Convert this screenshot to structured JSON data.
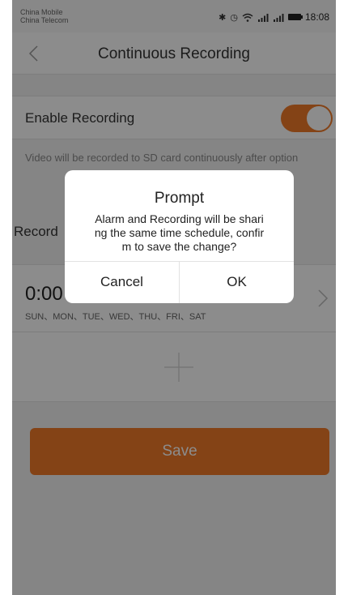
{
  "status_bar": {
    "carrier_1": "China Mobile",
    "carrier_2": "China Telecom",
    "time": "18:08",
    "icons": [
      "bluetooth-icon",
      "alarm-icon",
      "wifi-icon",
      "signal-icon",
      "signal-icon",
      "battery-icon"
    ]
  },
  "nav": {
    "title": "Continuous Recording",
    "back_icon": "chevron-left-icon"
  },
  "enable_recording": {
    "label": "Enable Recording",
    "enabled": true
  },
  "hint": "Video will be recorded to SD card continuously after option",
  "section_label": "Record",
  "schedule": {
    "time": "0:00",
    "days": "SUN、MON、TUE、WED、THU、FRI、SAT"
  },
  "add_icon": "plus-icon",
  "save_label": "Save",
  "dialog": {
    "title": "Prompt",
    "message": "Alarm and Recording will be shari\nng the same time schedule, confir\nm to save the change?",
    "cancel_label": "Cancel",
    "ok_label": "OK"
  },
  "colors": {
    "accent": "#f07a28",
    "background": "#f2f2f2",
    "overlay": "rgba(0,0,0,0.45)"
  }
}
